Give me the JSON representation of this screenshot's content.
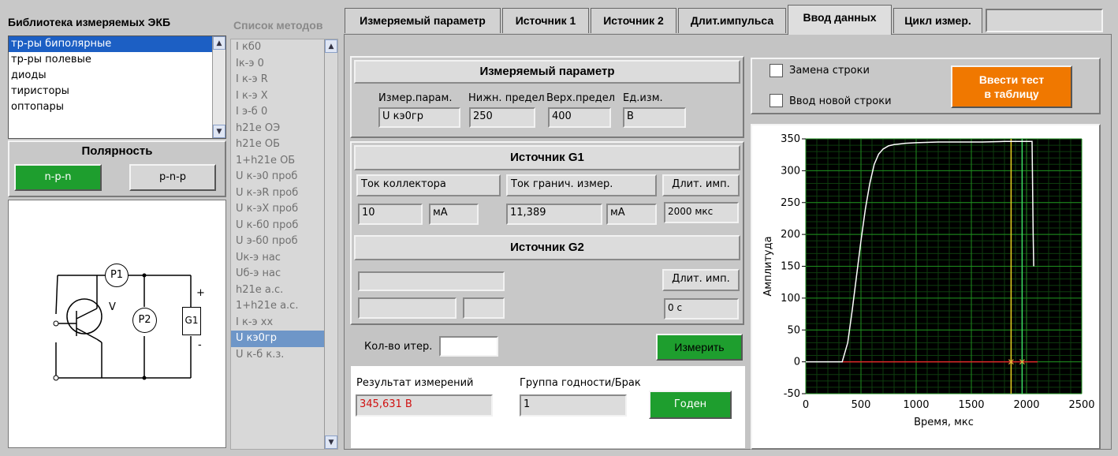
{
  "library": {
    "title": "Библиотека  измеряемых ЭКБ",
    "items": [
      "тр-ры биполярные",
      "тр-ры полевые",
      "диоды",
      "тиристоры",
      "оптопары"
    ],
    "selected_index": 0
  },
  "polarity": {
    "title": "Полярность",
    "npn_label": "n-p-n",
    "pnp_label": "p-n-p",
    "active": "n-p-n"
  },
  "schematic": {
    "p1_label": "P1",
    "p2_label": "P2",
    "g1_label": "G1",
    "v_label": "V",
    "plus": "+",
    "minus": "-"
  },
  "methods": {
    "title": "Список методов",
    "items": [
      "I кб0",
      "Iк-э 0",
      "I к-э R",
      "I к-э X",
      "I э-б 0",
      "h21e ОЭ",
      "h21e ОБ",
      "1+h21e ОБ",
      "U к-э0 проб",
      "U к-эR проб",
      "U к-эX проб",
      "U к-б0 проб",
      "U э-б0 проб",
      "Uк-э нас",
      "Uб-э нас",
      "h21e а.с.",
      "1+h21e а.с.",
      "I к-э хх",
      "U кэ0гр",
      "U к-б к.з."
    ],
    "selected_index": 18
  },
  "tabs": [
    {
      "label": "Измеряемый параметр"
    },
    {
      "label": "Источник 1"
    },
    {
      "label": "Источник 2"
    },
    {
      "label": "Длит.импульса"
    },
    {
      "label": "Ввод данных"
    },
    {
      "label": "Цикл измер."
    }
  ],
  "active_tab": 4,
  "measured_param": {
    "title": "Измеряемый параметр",
    "col_param": "Измер.парам.",
    "col_low": "Нижн. предел",
    "col_high": "Верх.предел",
    "col_unit": "Ед.изм.",
    "param_value": "U кэ0гр",
    "low_value": "250",
    "high_value": "400",
    "unit_value": "В"
  },
  "g1": {
    "title": "Источник G1",
    "collector_label": "Ток коллектора",
    "limit_label": "Ток гранич. измер.",
    "duration_label": "Длит. имп.",
    "collector_value": "10",
    "collector_unit": "мА",
    "limit_value": "11,389",
    "limit_unit": "мА",
    "duration_value": "2000 мкс"
  },
  "g2": {
    "title": "Источник G2",
    "duration_label": "Длит. имп.",
    "duration_value": "0 с"
  },
  "iterations": {
    "label": "Кол-во итер.",
    "value": ""
  },
  "measure_button": "Измерить",
  "result": {
    "label": "Результат измерений",
    "value": "345,631 В",
    "group_label": "Группа годности/Брак",
    "group_value": "1",
    "status": "Годен"
  },
  "options": {
    "replace_row": "Замена строки",
    "new_row": "Ввод новой строки",
    "enter_button_line1": "Ввести тест",
    "enter_button_line2": "в таблицу"
  },
  "colors": {
    "accent_green": "#1e9e2e",
    "orange": "#f07800",
    "selection_blue": "#1c5fc4",
    "plot_bg": "#000000",
    "plot_grid": "#1f8f1f",
    "trace": "#ffffff",
    "cursor_yellow": "#e8d020",
    "cursor_green": "#3cdc64",
    "baseline_red": "#e02828",
    "result_text": "#d01010"
  },
  "chart_data": {
    "type": "line",
    "xlabel": "Время, мкс",
    "ylabel": "Амплитуда",
    "xlim": [
      0,
      2500
    ],
    "ylim": [
      -50,
      350
    ],
    "xticks": [
      0,
      500,
      1000,
      1500,
      2000,
      2500
    ],
    "yticks": [
      -50,
      0,
      50,
      100,
      150,
      200,
      250,
      300,
      350
    ],
    "grid": true,
    "series": [
      {
        "x": [
          0,
          330,
          380,
          420,
          460,
          500,
          540,
          580,
          620,
          660,
          700,
          750,
          800,
          850,
          900,
          1000,
          1200,
          1400,
          1600,
          1800,
          2000,
          2050,
          2060,
          2065
        ],
        "y": [
          0,
          0,
          30,
          80,
          135,
          190,
          240,
          280,
          310,
          326,
          334,
          339,
          341,
          342,
          343,
          344,
          345,
          345,
          345,
          346,
          346,
          346,
          200,
          150
        ]
      }
    ],
    "baseline": {
      "x_start": 330,
      "x_end": 2100,
      "y": 0
    },
    "cursors": [
      {
        "x": 1860
      },
      {
        "x": 1960
      }
    ]
  }
}
